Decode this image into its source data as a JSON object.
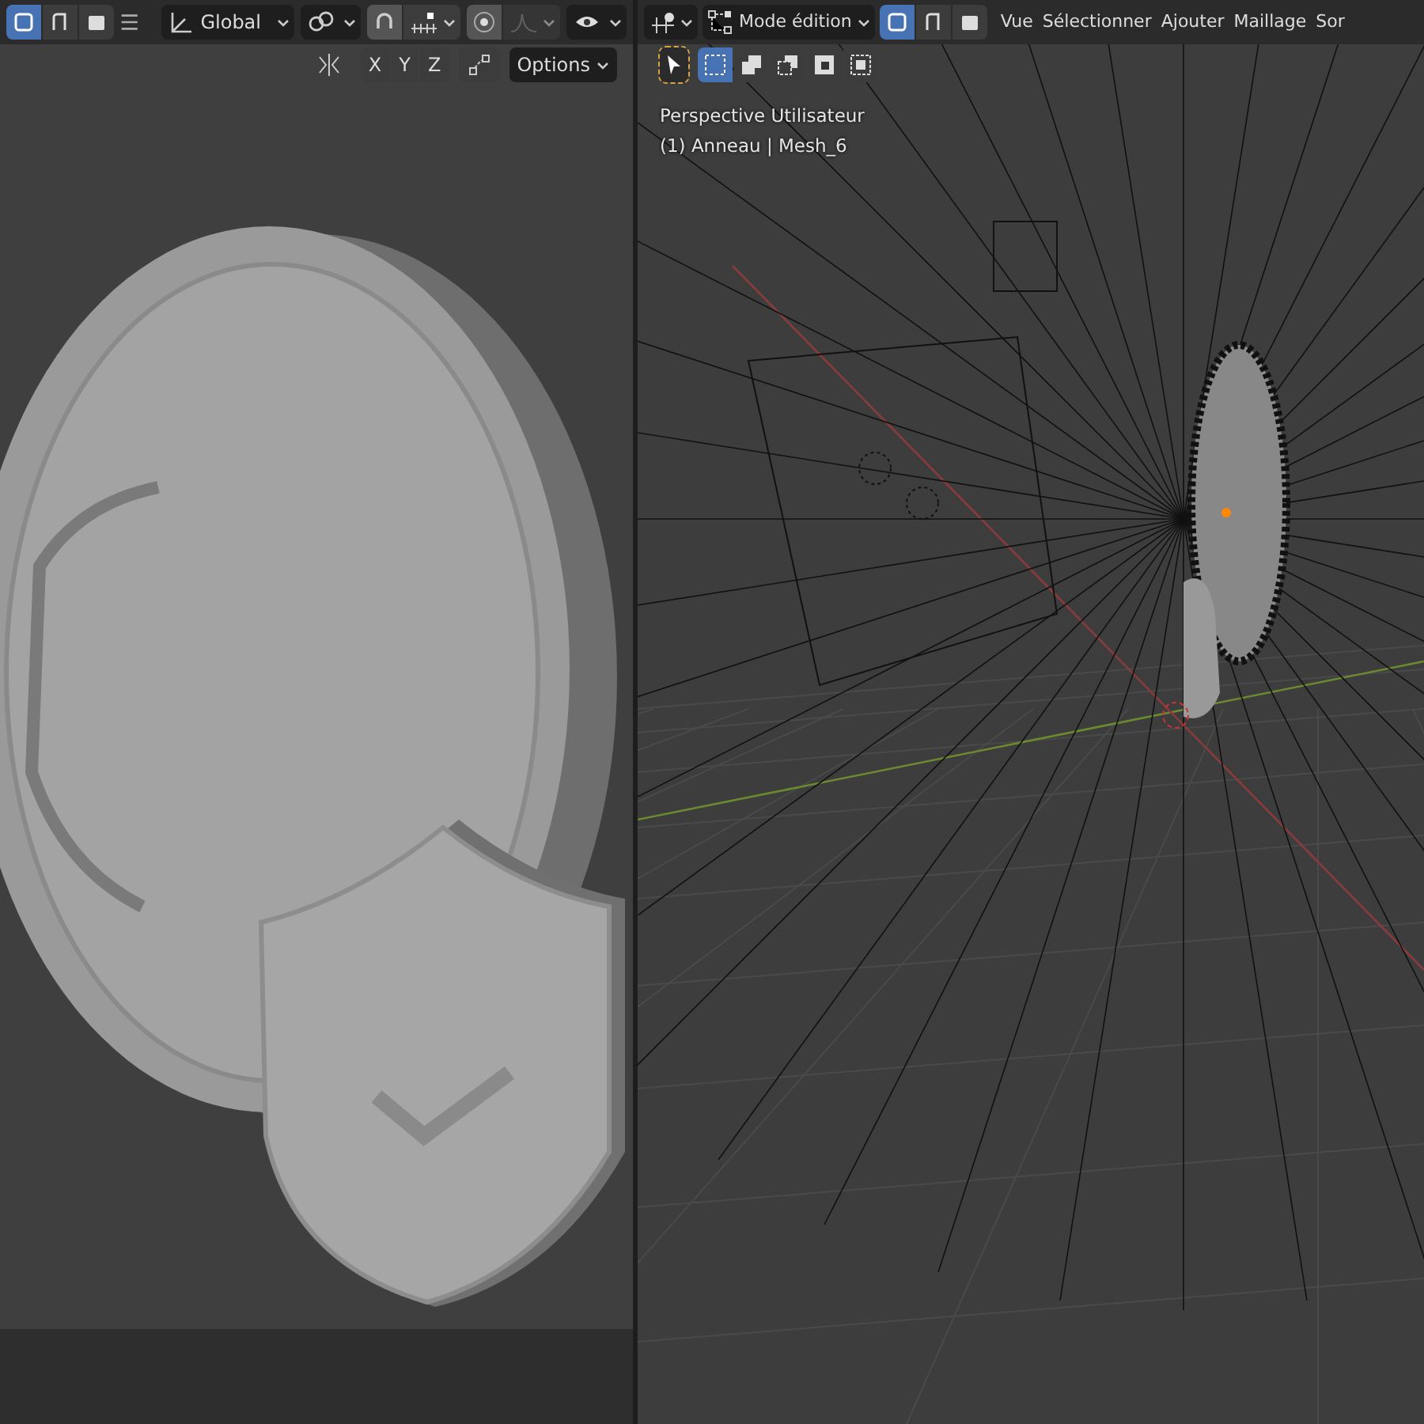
{
  "left_editor": {
    "select_modes": [
      {
        "selected": true
      },
      {
        "selected": false
      },
      {
        "selected": false
      }
    ],
    "orientation": "Global",
    "axes": [
      {
        "label": "X",
        "selected": false
      },
      {
        "label": "Y",
        "selected": false
      },
      {
        "label": "Z",
        "selected": false
      }
    ],
    "options": "Options"
  },
  "right_editor": {
    "mode": "Mode édition",
    "select_modes": [
      {
        "selected": true
      },
      {
        "selected": false
      },
      {
        "selected": false
      }
    ],
    "menus": [
      "Vue",
      "Sélectionner",
      "Ajouter",
      "Maillage",
      "Sor"
    ],
    "select_tool": {
      "selected": true
    },
    "box_modes": [
      {
        "selected": true
      },
      {
        "selected": false
      },
      {
        "selected": false
      },
      {
        "selected": false
      },
      {
        "selected": false
      }
    ],
    "view_name": "Perspective Utilisateur",
    "object_info": "(1) Anneau | Mesh_6"
  }
}
